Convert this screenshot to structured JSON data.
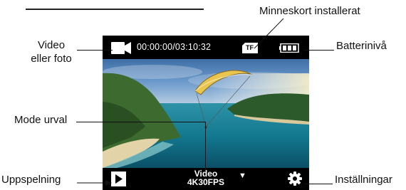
{
  "labels": {
    "video_photo_line1": "Video",
    "video_photo_line2": "eller foto",
    "memory_card": "Minneskort installerat",
    "battery": "Batterinivå",
    "mode_select": "Mode urval",
    "playback": "Uppspelning",
    "settings": "Inställningar"
  },
  "screen": {
    "time": "00:00:00/03:10:32",
    "card_text": "TF",
    "mode_line1": "Video",
    "mode_line2": "4K30FPS",
    "mode_arrow": "▼"
  },
  "icons": {
    "video": "video-camera-icon",
    "card": "sd-card-icon",
    "battery": "battery-icon",
    "playback": "play-icon",
    "settings": "gear-icon"
  },
  "colors": {
    "bar": "#000000",
    "text": "#ffffff",
    "sky": "#6f9ccd",
    "sea": "#15768e",
    "kite": "#e8c54e"
  }
}
